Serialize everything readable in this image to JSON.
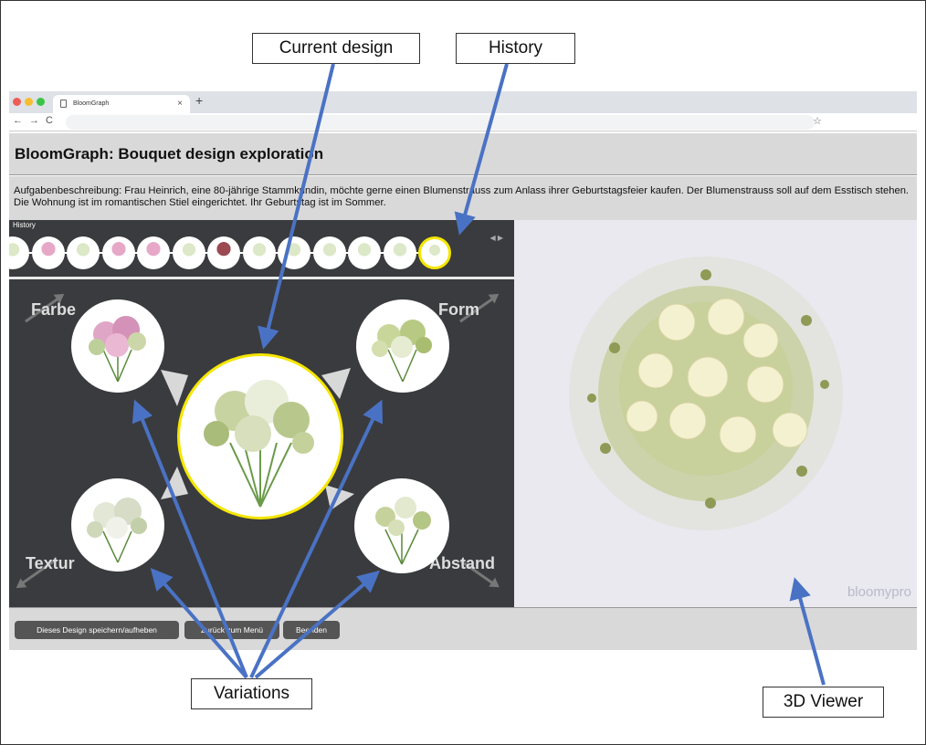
{
  "callouts": {
    "current_design": "Current design",
    "history": "History",
    "variations": "Variations",
    "viewer": "3D Viewer"
  },
  "browser": {
    "tab_title": "BloomGraph",
    "tab_close": "×",
    "new_tab": "+",
    "back": "←",
    "forward": "→",
    "reload": "C",
    "bookmark": "☆",
    "icons": {
      "close": "close-icon",
      "new_tab": "plus-icon",
      "bookmark": "star-icon"
    }
  },
  "app": {
    "title": "BloomGraph: Bouquet design exploration",
    "task": "Aufgabenbeschreibung: Frau Heinrich, eine 80-jährige Stammkundin, möchte gerne einen Blumenstrauss zum Anlass ihrer Geburtstagsfeier kaufen. Der Blumenstrauss soll auf dem Esstisch stehen. Die Wohnung ist im romantischen Stiel eingerichtet. Ihr Geburtstag ist im Sommer."
  },
  "history": {
    "label": "History",
    "nav": "◀ ▶",
    "item_count": 13,
    "selected_index": 12
  },
  "variations": {
    "color": "Farbe",
    "shape": "Form",
    "texture": "Textur",
    "spacing": "Abstand"
  },
  "viewer": {
    "brand": "bloomypro"
  },
  "footer": {
    "save": "Dieses Design speichern/aufheben",
    "back_to_menu": "Zurück zum Menü",
    "finish": "Beenden"
  },
  "colors": {
    "selection": "#f5e600",
    "annotation_arrow": "#4a72c4",
    "panel_dark": "#3a3b3e",
    "panel_light": "#e9e9ef"
  }
}
